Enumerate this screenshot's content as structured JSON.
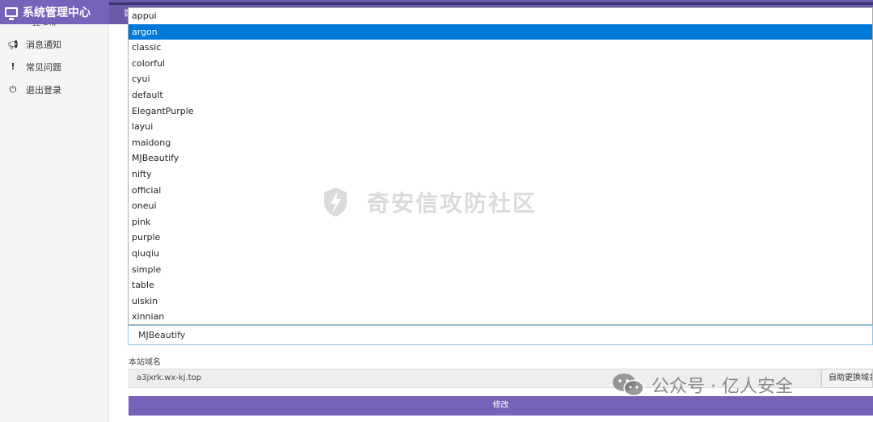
{
  "header": {
    "title": "系统管理中心",
    "nav_edge": "首"
  },
  "sidebar": {
    "cut_item": "站点设置",
    "items": [
      {
        "label": "消息通知",
        "icon": "megaphone-icon"
      },
      {
        "label": "常见问题",
        "icon": "info-icon"
      },
      {
        "label": "退出登录",
        "icon": "power-icon"
      }
    ]
  },
  "template_list": {
    "options": [
      "appui",
      "argon",
      "classic",
      "colorful",
      "cyui",
      "default",
      "ElegantPurple",
      "layui",
      "maidong",
      "MJBeautify",
      "nifty",
      "official",
      "oneui",
      "pink",
      "purple",
      "qiuqiu",
      "simple",
      "table",
      "uiskin",
      "xinnian"
    ],
    "highlighted": "argon"
  },
  "template_select": {
    "value": "MJBeautify"
  },
  "domain": {
    "label": "本站域名",
    "value": "a3jxrk.wx-kj.top",
    "button_label": "自助更换域名"
  },
  "submit_label": "修改",
  "watermark": {
    "text": "奇安信攻防社区"
  },
  "wechat_mark": {
    "text": "公众号 · 亿人安全"
  },
  "colors": {
    "accent": "#7762b9",
    "selected": "#0078d7"
  }
}
